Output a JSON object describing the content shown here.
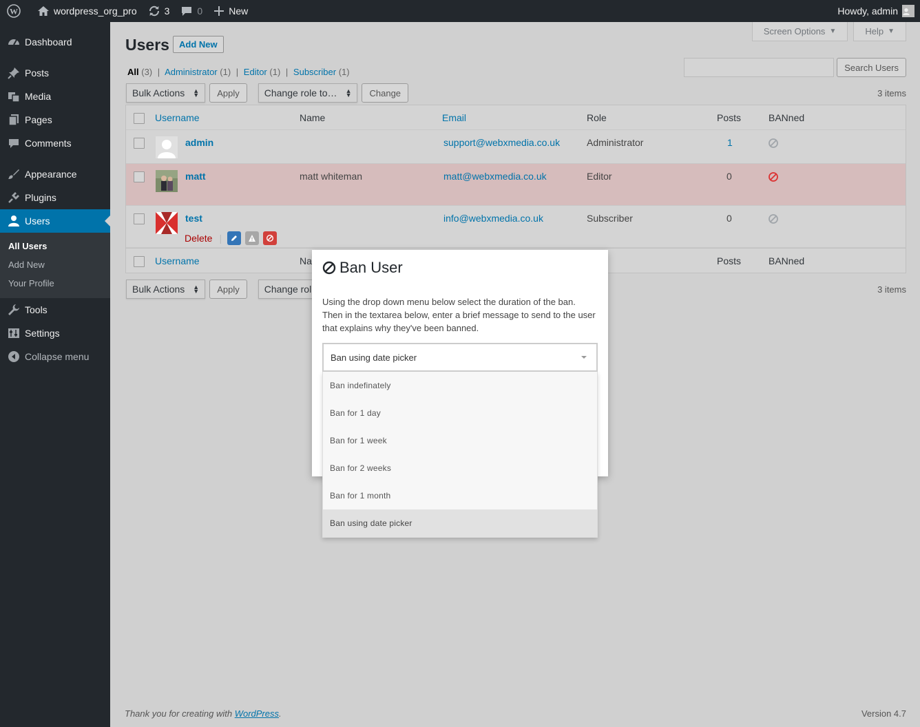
{
  "adminbar": {
    "site_name": "wordpress_org_pro",
    "updates_count": "3",
    "comments_count": "0",
    "new_label": "New",
    "howdy": "Howdy, admin"
  },
  "sidebar": {
    "items": [
      {
        "label": "Dashboard",
        "icon": "dashboard-icon"
      },
      {
        "label": "Posts",
        "icon": "pin-icon"
      },
      {
        "label": "Media",
        "icon": "media-icon"
      },
      {
        "label": "Pages",
        "icon": "pages-icon"
      },
      {
        "label": "Comments",
        "icon": "comment-icon"
      },
      {
        "label": "Appearance",
        "icon": "brush-icon"
      },
      {
        "label": "Plugins",
        "icon": "plug-icon"
      },
      {
        "label": "Users",
        "icon": "user-icon"
      },
      {
        "label": "Tools",
        "icon": "wrench-icon"
      },
      {
        "label": "Settings",
        "icon": "settings-icon"
      },
      {
        "label": "Collapse menu",
        "icon": "collapse-icon"
      }
    ],
    "submenu": [
      "All Users",
      "Add New",
      "Your Profile"
    ]
  },
  "screen_meta": {
    "screen_options": "Screen Options",
    "help": "Help"
  },
  "page": {
    "title": "Users",
    "add_new": "Add New",
    "filters": {
      "all": "All",
      "all_count": "(3)",
      "administrator": "Administrator",
      "administrator_count": "(1)",
      "editor": "Editor",
      "editor_count": "(1)",
      "subscriber": "Subscriber",
      "subscriber_count": "(1)"
    },
    "search_button": "Search Users",
    "bulk_actions": "Bulk Actions",
    "apply": "Apply",
    "change_role": "Change role to…",
    "change_role_short": "Change rol",
    "change": "Change",
    "items_count": "3 items"
  },
  "table": {
    "columns": {
      "username": "Username",
      "name": "Name",
      "email": "Email",
      "role": "Role",
      "posts": "Posts",
      "banned": "BANned"
    },
    "footer_name_partial": "Na",
    "rows": [
      {
        "username": "admin",
        "name": "",
        "email": "support@webxmedia.co.uk",
        "role": "Administrator",
        "posts": "1",
        "banned": false
      },
      {
        "username": "matt",
        "name": "matt whiteman",
        "email": "matt@webxmedia.co.uk",
        "role": "Editor",
        "posts": "0",
        "banned": true
      },
      {
        "username": "test",
        "name": "",
        "email": "info@webxmedia.co.uk",
        "role": "Subscriber",
        "posts": "0",
        "banned": false
      }
    ],
    "row_action_delete": "Delete"
  },
  "modal": {
    "title": "Ban User",
    "text": "Using the drop down menu below select the duration of the ban. Then in the textarea below, enter a brief message to send to the user that explains why they've been banned.",
    "selected": "Ban using date picker",
    "options": [
      "Ban indefinately",
      "Ban for 1 day",
      "Ban for 1 week",
      "Ban for 2 weeks",
      "Ban for 1 month",
      "Ban using date picker"
    ]
  },
  "footer": {
    "thanks_prefix": "Thank you for creating with ",
    "thanks_link": "WordPress",
    "thanks_suffix": ".",
    "version": "Version 4.7"
  },
  "colors": {
    "accent": "#0073aa",
    "sidebar_bg": "#23282d",
    "banned_red": "#dc3232",
    "banned_row": "#d6bcbc"
  }
}
